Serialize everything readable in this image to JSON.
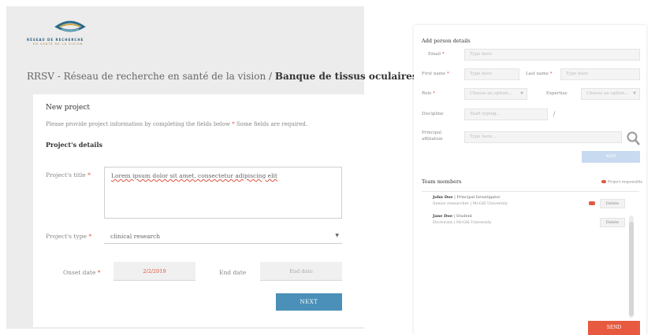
{
  "colors": {
    "accent": "#4a90b8",
    "required": "#e0503d",
    "send": "#e85a3f"
  },
  "brand": {
    "line1": "RÉSEAU DE RECHERCHE",
    "line2": "EN SANTÉ DE LA VISION"
  },
  "page": {
    "title_prefix": "RRSV - Réseau de recherche en santé de la vision / ",
    "title_bold": "Banque de tissus oculaires"
  },
  "form": {
    "heading": "New project",
    "description": "Please provide project information by completing the fields below",
    "required_star": "*",
    "required_note": "Some fields are required.",
    "details_heading": "Project's details",
    "title_label": "Project's title",
    "title_value": "Lorem ipsum dolor sit amet, consectetur adipiscing elit",
    "type_label": "Project's type",
    "type_value": "clinical research",
    "onset_label": "Onset date",
    "onset_value": "2/2/2019",
    "end_label": "End date",
    "end_placeholder": "End date",
    "next_label": "NEXT"
  },
  "person": {
    "heading": "Add person details",
    "email_label": "Email",
    "email_placeholder": "Type here",
    "first_label": "First name",
    "first_placeholder": "Type here",
    "last_label": "Last name",
    "last_placeholder": "Type here",
    "role_label": "Role",
    "role_placeholder": "Choose an option...",
    "expertise_label": "Expertise",
    "expertise_placeholder": "Choose an option...",
    "discipline_label": "Discipline",
    "discipline_placeholder": "Start typing...",
    "discipline_sep": "/",
    "affiliation_label_1": "Principal",
    "affiliation_label_2": "affiliation",
    "affiliation_placeholder": "Type here...",
    "add_label": "ADD"
  },
  "team": {
    "heading": "Team members",
    "legend": "Project responsible",
    "members": [
      {
        "name": "John Doe",
        "role": "Principal Investigator",
        "detail": "Senior researcher | McGill University",
        "delete": "Delete"
      },
      {
        "name": "Jane Doe",
        "role": "Student",
        "detail": "Doctorate | McGill University",
        "delete": "Delete"
      }
    ],
    "send_label": "SEND"
  }
}
